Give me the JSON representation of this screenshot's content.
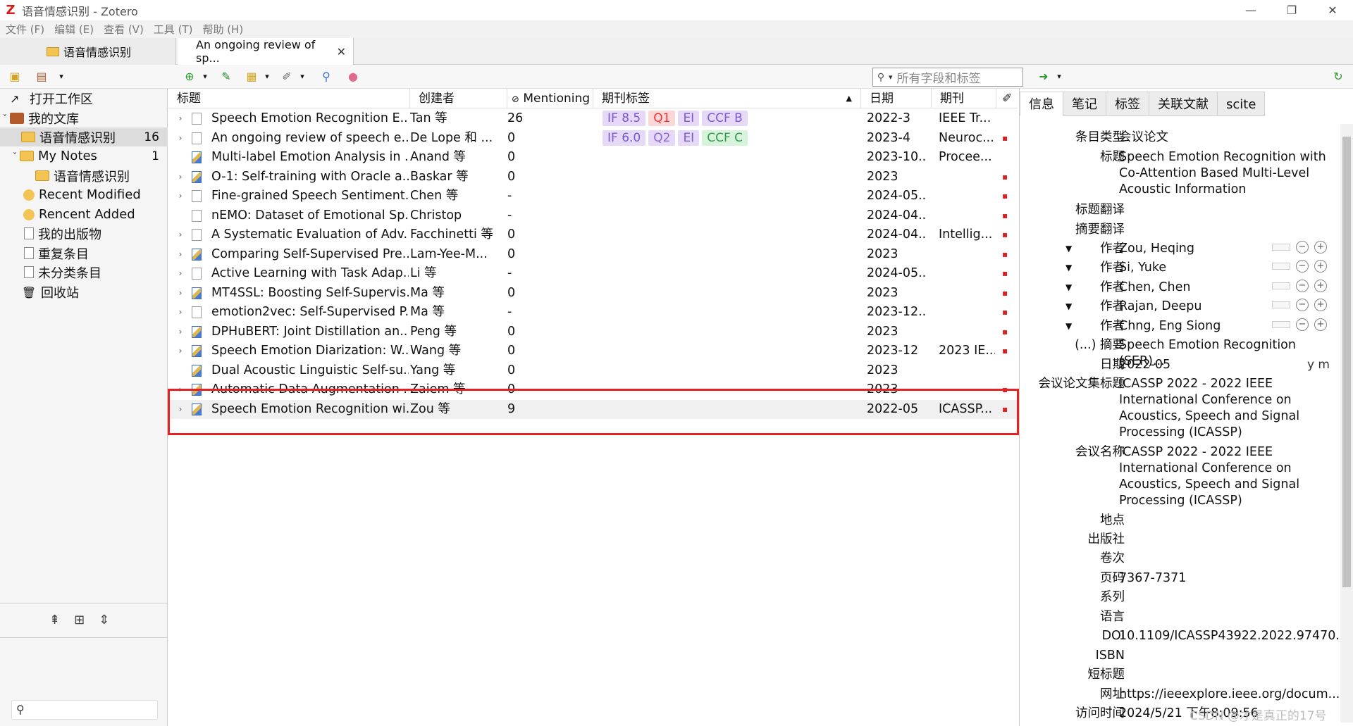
{
  "window": {
    "title": "语音情感识别 - Zotero",
    "app_icon": "Z",
    "minimize": "—",
    "restore": "❐",
    "close": "✕"
  },
  "menu": [
    "文件 (F)",
    "编辑 (E)",
    "查看 (V)",
    "工具 (T)",
    "帮助 (H)"
  ],
  "tabs": [
    {
      "label": "语音情感识别"
    },
    {
      "label": "An ongoing review of sp...",
      "close": "✕"
    }
  ],
  "search": {
    "placeholder": "所有字段和标签"
  },
  "collections": [
    {
      "label": "打开工作区",
      "count": ""
    },
    {
      "label": "我的文库",
      "count": ""
    },
    {
      "label": "语音情感识别",
      "count": "16"
    },
    {
      "label": "My Notes",
      "count": "1"
    },
    {
      "label": "语音情感识别",
      "count": ""
    },
    {
      "label": "Recent Modified",
      "count": ""
    },
    {
      "label": "Rencent Added",
      "count": ""
    },
    {
      "label": "我的出版物",
      "count": ""
    },
    {
      "label": "重复条目",
      "count": ""
    },
    {
      "label": "未分类条目",
      "count": ""
    },
    {
      "label": "回收站",
      "count": ""
    }
  ],
  "columns": {
    "title": "标题",
    "creator": "创建者",
    "mention": "Mentioning",
    "tags": "期刊标签",
    "date": "日期",
    "pub": "期刊"
  },
  "rows": [
    {
      "title": "Speech Emotion Recognition E...",
      "creator": "Tan 等",
      "mention": "26",
      "tags": [
        "IF 8.5",
        "Q1",
        "EI",
        "CCF B"
      ],
      "date": "2022-3",
      "pub": "IEEE Tr...",
      "pdf": false
    },
    {
      "title": "An ongoing review of speech e...",
      "creator": "De Lope 和 ...",
      "mention": "0",
      "tags": [
        "IF 6.0",
        "Q2",
        "EI",
        "CCF C"
      ],
      "date": "2023-4",
      "pub": "Neuroc...",
      "pdf": true
    },
    {
      "title": "Multi-label Emotion Analysis in ...",
      "creator": "Anand 等",
      "mention": "0",
      "tags": [],
      "date": "2023-10...",
      "pub": "Procee...",
      "pdf": false
    },
    {
      "title": "O-1: Self-training with Oracle a...",
      "creator": "Baskar 等",
      "mention": "0",
      "tags": [],
      "date": "2023",
      "pub": "",
      "pdf": true
    },
    {
      "title": "Fine-grained Speech Sentiment...",
      "creator": "Chen 等",
      "mention": "-",
      "tags": [],
      "date": "2024-05...",
      "pub": "",
      "pdf": true
    },
    {
      "title": "nEMO: Dataset of Emotional Sp...",
      "creator": "Christop",
      "mention": "-",
      "tags": [],
      "date": "2024-04...",
      "pub": "",
      "pdf": true
    },
    {
      "title": "A Systematic Evaluation of Adv...",
      "creator": "Facchinetti 等",
      "mention": "0",
      "tags": [],
      "date": "2024-04...",
      "pub": "Intellig...",
      "pdf": true
    },
    {
      "title": "Comparing Self-Supervised Pre...",
      "creator": "Lam-Yee-M...",
      "mention": "0",
      "tags": [],
      "date": "2023",
      "pub": "",
      "pdf": true
    },
    {
      "title": "Active Learning with Task Adap...",
      "creator": "Li 等",
      "mention": "-",
      "tags": [],
      "date": "2024-05...",
      "pub": "",
      "pdf": true
    },
    {
      "title": "MT4SSL: Boosting Self-Supervis...",
      "creator": "Ma 等",
      "mention": "0",
      "tags": [],
      "date": "2023",
      "pub": "",
      "pdf": true
    },
    {
      "title": "emotion2vec: Self-Supervised P...",
      "creator": "Ma 等",
      "mention": "-",
      "tags": [],
      "date": "2023-12...",
      "pub": "",
      "pdf": true
    },
    {
      "title": "DPHuBERT: Joint Distillation an...",
      "creator": "Peng 等",
      "mention": "0",
      "tags": [],
      "date": "2023",
      "pub": "",
      "pdf": true
    },
    {
      "title": "Speech Emotion Diarization: W...",
      "creator": "Wang 等",
      "mention": "0",
      "tags": [],
      "date": "2023-12",
      "pub": "2023 IE...",
      "pdf": true
    },
    {
      "title": "Dual Acoustic Linguistic Self-su...",
      "creator": "Yang 等",
      "mention": "0",
      "tags": [],
      "date": "2023",
      "pub": "",
      "pdf": false
    },
    {
      "title": "Automatic Data Augmentation ...",
      "creator": "Zaiem 等",
      "mention": "0",
      "tags": [],
      "date": "2023",
      "pub": "",
      "pdf": true
    },
    {
      "title": "Speech Emotion Recognition wi...",
      "creator": "Zou 等",
      "mention": "9",
      "tags": [],
      "date": "2022-05",
      "pub": "ICASSP...",
      "pdf": true
    }
  ],
  "right_tabs": [
    "信息",
    "笔记",
    "标签",
    "关联文献",
    "scite"
  ],
  "info": {
    "item_type_label": "条目类型",
    "item_type": "会议论文",
    "title_label": "标题",
    "title": "Speech Emotion Recognition with Co-Attention Based Multi-Level Acoustic Information",
    "title_trans_label": "标题翻译",
    "abstract_trans_label": "摘要翻译",
    "author_label": "作者",
    "authors": [
      "Zou, Heqing",
      "Si, Yuke",
      "Chen, Chen",
      "Rajan, Deepu",
      "Chng, Eng Siong"
    ],
    "abstract_label": "(...) 摘要",
    "abstract": "Speech Emotion Recognition (SER)...",
    "date_label": "日期",
    "date": "2022-05",
    "date_hint": "y m",
    "proc_label": "会议论文集标题",
    "proc": "ICASSP 2022 - 2022 IEEE International Conference on Acoustics, Speech and Signal Processing (ICASSP)",
    "conf_label": "会议名称",
    "conf": "ICASSP 2022 - 2022 IEEE International Conference on Acoustics, Speech and Signal Processing (ICASSP)",
    "place_label": "地点",
    "publisher_label": "出版社",
    "volume_label": "卷次",
    "pages_label": "页码",
    "pages": "7367-7371",
    "series_label": "系列",
    "lang_label": "语言",
    "doi_label": "DOI",
    "doi": "10.1109/ICASSP43922.2022.97470...",
    "isbn_label": "ISBN",
    "short_label": "短标题",
    "url_label": "网址",
    "url": "https://ieeexplore.ieee.org/docum...",
    "access_label": "访问时间",
    "access": "2024/5/21 下午8:09:56"
  },
  "watermark": "CSDN @才是真正的17号"
}
